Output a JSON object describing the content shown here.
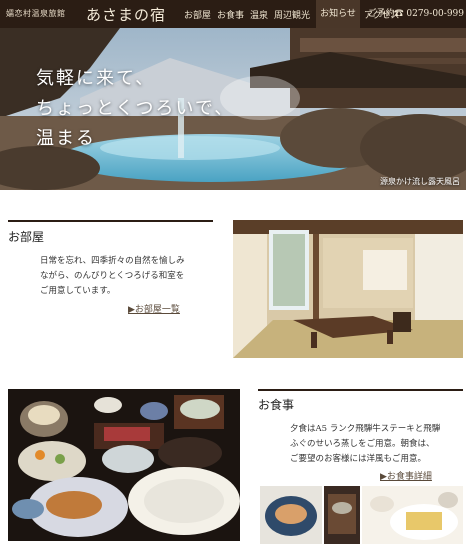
{
  "header": {
    "logo_sub": "嬬恋村温泉旅館",
    "logo_main": "あさまの宿"
  },
  "nav": {
    "items": [
      "お部屋",
      "お食事",
      "温泉",
      "周辺観光"
    ],
    "active": "お知らせ",
    "access": "アクセス",
    "reserve": "ご予約☎ 0279-00-999"
  },
  "hero": {
    "lines": [
      "気軽に来て、",
      "ちょっとくつろいで、",
      "温まる"
    ],
    "photo_caption": "源泉かけ流し露天風呂"
  },
  "rooms": {
    "title": "お部屋",
    "lines": [
      "日常を忘れ、四季折々の自然を愉しみ",
      "ながら、のんびりとくつろげる和室を",
      "ご用意しています。"
    ],
    "link": "▶お部屋一覧"
  },
  "meals": {
    "title": "お食事",
    "lines": [
      "夕食はA5 ランク飛騨牛ステーキと飛騨",
      "ふぐのせいろ蒸しをご用意。朝食は、",
      "ご要望のお客様には洋風もご用意。"
    ],
    "link": "▶お食事詳細"
  }
}
